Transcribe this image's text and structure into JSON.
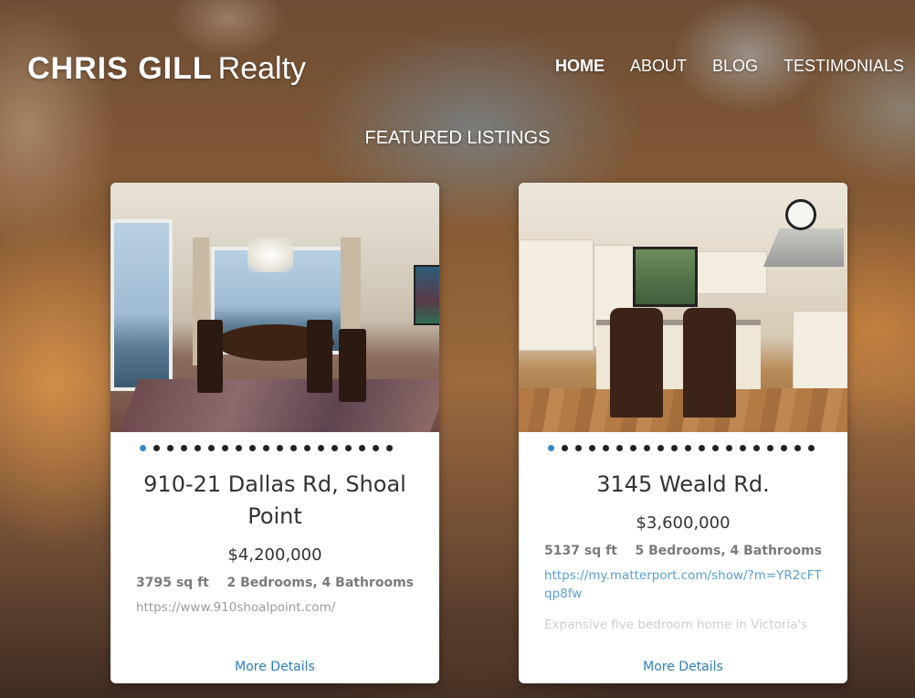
{
  "logo": {
    "bold": "CHRIS GILL",
    "light": "Realty"
  },
  "nav": {
    "items": [
      {
        "label": "HOME"
      },
      {
        "label": "ABOUT"
      },
      {
        "label": "BLOG"
      },
      {
        "label": "TESTIMONIALS"
      }
    ]
  },
  "section": {
    "title": "FEATURED LISTINGS"
  },
  "listings": [
    {
      "title": "910-21 Dallas Rd, Shoal Point",
      "price": "$4,200,000",
      "sqft": "3795 sq ft",
      "rooms": "2 Bedrooms, 4 Bathrooms",
      "link": "https://www.910shoalpoint.com/",
      "description": "",
      "more_label": "More Details",
      "photo_count": 19,
      "active_photo": 1
    },
    {
      "title": "3145 Weald Rd.",
      "price": "$3,600,000",
      "sqft": "5137 sq ft",
      "rooms": "5 Bedrooms, 4 Bathrooms",
      "link": "https://my.matterport.com/show/?m=YR2cFTqp8fw",
      "description": "Expansive five bedroom home in Victoria's",
      "more_label": "More Details",
      "photo_count": 20,
      "active_photo": 1
    }
  ],
  "colors": {
    "accent": "#3a88c5",
    "link": "#2f7db8"
  }
}
